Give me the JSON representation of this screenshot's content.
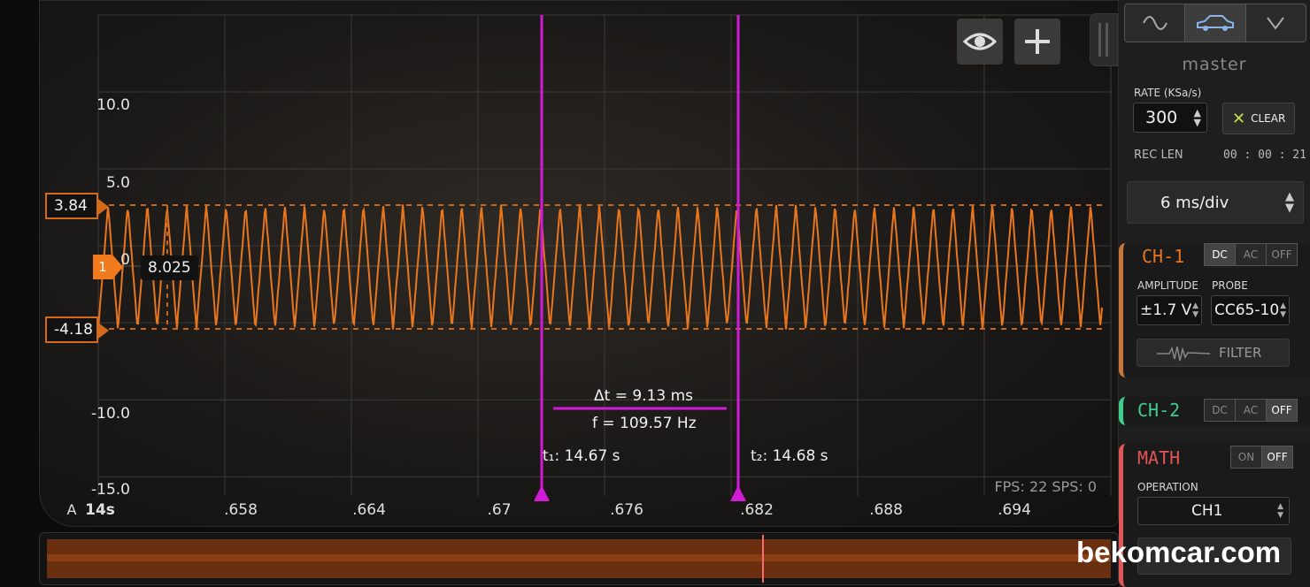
{
  "scope": {
    "y_labels": [
      "10.0",
      "5.0",
      "0",
      "-10.0",
      "-15.0"
    ],
    "x_labels": [
      "14s",
      ".658",
      ".664",
      ".67",
      ".676",
      ".682",
      ".688",
      ".694"
    ],
    "x_prefix": "A",
    "fps_text": "FPS: 22  SPS: 0",
    "upper_level": "3.84",
    "lower_level": "-4.18",
    "channel_tag": "1",
    "trigger_value": "8.025",
    "cursor": {
      "delta_t": "Δt = 9.13 ms",
      "freq": "f = 109.57 Hz",
      "t1": "t₁: 14.67 s",
      "t2": "t₂: 14.68 s"
    },
    "trace_color": "#e8761e",
    "cursor_color": "#d21bd6",
    "icons": [
      "eye-icon",
      "plus-icon"
    ]
  },
  "side": {
    "tabs": [
      "sine-wave-icon",
      "car-icon",
      "chevron-down-icon"
    ],
    "master_label": "master",
    "rate_label": "RATE (KSa/s)",
    "rate_value": "300",
    "clear_label": "CLEAR",
    "rec_len_label": "REC LEN",
    "rec_len_value": "00 : 00 : 21",
    "timebase": "6 ms/div",
    "ch1": {
      "name": "CH-1",
      "modes": [
        "DC",
        "AC",
        "OFF"
      ],
      "amplitude_label": "AMPLITUDE",
      "amplitude_value": "±1.7 V",
      "probe_label": "PROBE",
      "probe_value": "CC65-10",
      "filter_label": "FILTER",
      "color": "#e8761e"
    },
    "ch2": {
      "name": "CH-2",
      "modes": [
        "DC",
        "AC",
        "OFF"
      ],
      "color": "#3ecf8e"
    },
    "math": {
      "name": "MATH",
      "modes": [
        "ON",
        "OFF"
      ],
      "operation_label": "OPERATION",
      "operation_value": "CH1",
      "color": "#e05555"
    }
  },
  "watermark": "bekomcar.com"
}
